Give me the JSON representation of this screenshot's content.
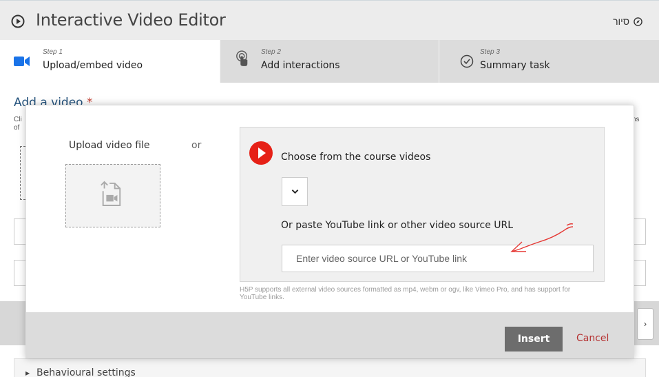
{
  "header": {
    "title": "Interactive Video Editor",
    "tour_label": "סיור",
    "play_icon": "play-circle-icon",
    "tour_icon": "compass-icon"
  },
  "steps": [
    {
      "small": "Step 1",
      "label": "Upload/embed video",
      "icon": "video-camera-icon",
      "active": true
    },
    {
      "small": "Step 2",
      "label": "Add interactions",
      "icon": "touch-icon",
      "active": false
    },
    {
      "small": "Step 3",
      "label": "Summary task",
      "icon": "check-circle-icon",
      "active": false
    }
  ],
  "page": {
    "add_video_label": "Add a video",
    "required_mark": "*",
    "desc_left_line1": "Cli",
    "desc_left_line2": "of",
    "desc_right": "ns",
    "next_arrow": "›",
    "behaviour_label": "Behavioural settings"
  },
  "modal": {
    "upload_label": "Upload video file",
    "or_label": "or",
    "choose_label": "Choose from the course videos",
    "paste_label": "Or paste YouTube link or other video source URL",
    "url_placeholder": "Enter video source URL or YouTube link",
    "url_value": "",
    "support_note": "H5P supports all external video sources formatted as mp4, webm or ogv, like Vimeo Pro, and has support for YouTube links.",
    "insert_label": "Insert",
    "cancel_label": "Cancel"
  },
  "colors": {
    "accent_blue": "#1a73e8",
    "youtube_red": "#e62117",
    "cancel_red": "#b53131",
    "annotation_red": "#e53935"
  }
}
